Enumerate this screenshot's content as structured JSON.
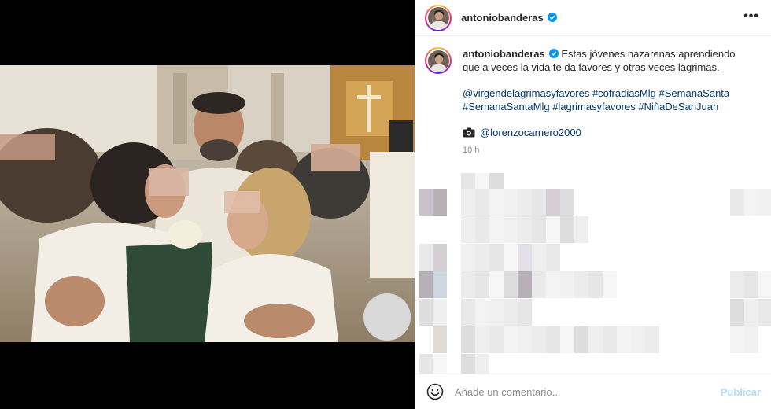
{
  "post": {
    "username": "antoniobanderas",
    "caption": "Estas jóvenes nazarenas aprendiendo que a veces la vida te da favores y otras veces lágrimas.",
    "hashtags": [
      "@virgendelagrimasyfavores",
      "#cofradiasMlg",
      "#SemanaSanta",
      "#SemanaSantaMlg",
      "#lagrimasyfavores",
      "#NiñaDeSanJuan"
    ],
    "credit_icon": "camera-icon",
    "credit": "@lorenzocarnero2000",
    "time": "10 h"
  },
  "comment_bar": {
    "placeholder": "Añade un comentario...",
    "publish_label": "Publicar"
  },
  "colors": {
    "link": "#00376b",
    "verified": "#0095f6",
    "publish_disabled": "#b3dbff",
    "muted": "#8e8e8e"
  }
}
